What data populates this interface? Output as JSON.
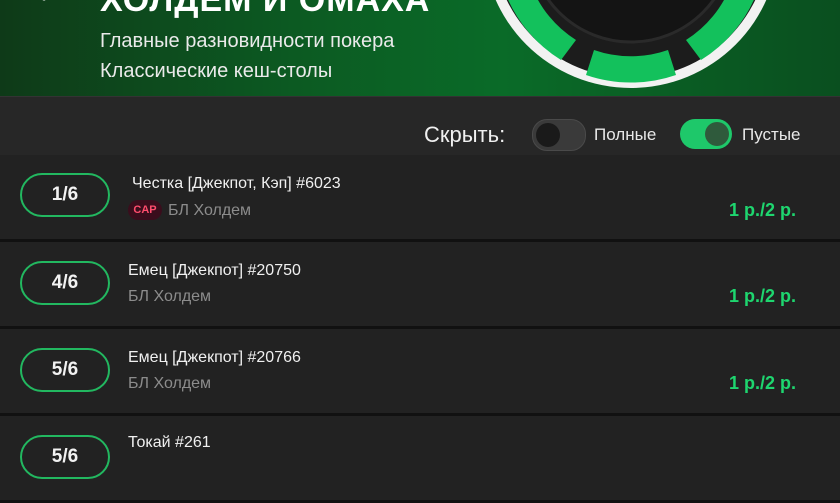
{
  "header": {
    "title": "ХОЛДЕМ И ОМАХА",
    "subtitle1": "Главные разновидности покера",
    "subtitle2": "Классические кеш-столы"
  },
  "filters": {
    "hide_label": "Скрыть:",
    "full_label": "Полные",
    "full_on": false,
    "empty_label": "Пустые",
    "empty_on": true
  },
  "tables": [
    {
      "seats": "1/6",
      "name": "Честка [Джекпот, Кэп] #6023",
      "badge": "CAP",
      "type": "БЛ Холдем",
      "stakes": "1 р./2 р."
    },
    {
      "seats": "4/6",
      "name": "Емец [Джекпот] #20750",
      "type": "БЛ Холдем",
      "stakes": "1 р./2 р."
    },
    {
      "seats": "5/6",
      "name": "Емец [Джекпот] #20766",
      "type": "БЛ Холдем",
      "stakes": "1 р./2 р."
    },
    {
      "seats": "5/6",
      "name": "Токай #261",
      "type": "",
      "stakes": ""
    }
  ],
  "colors": {
    "accent": "#1ed66f",
    "badge": "#ff4d6d"
  }
}
